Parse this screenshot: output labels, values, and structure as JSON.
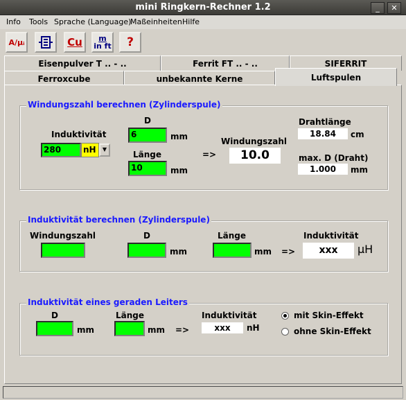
{
  "window": {
    "title": "mini Ringkern-Rechner 1.2",
    "minimize": "_",
    "maximize": "□",
    "close": "✕"
  },
  "menu": [
    "Info",
    "Tools",
    "Sprache (Language)",
    "Maßeinheiten",
    "Hilfe"
  ],
  "toolbar": {
    "btn1": "A/μᵢ",
    "btn3": "Cu",
    "btn4_top": "m",
    "btn4_bottom": "in ft",
    "btn5": "?"
  },
  "tabs_back": [
    "Eisenpulver T .. - ..",
    "Ferrit FT .. - ..",
    "SIFERRIT"
  ],
  "tabs_front": [
    "Ferroxcube",
    "unbekannte Kerne",
    "Luftspulen"
  ],
  "section1": {
    "title": "Windungszahl berechnen (Zylinderspule)",
    "inductance_label": "Induktivität",
    "inductance_value": "280",
    "inductance_unit": "nH",
    "d_label": "D",
    "d_value": "6",
    "d_unit": "mm",
    "length_label": "Länge",
    "length_value": "10",
    "length_unit": "mm",
    "arrow": "=>",
    "turns_label": "Windungszahl",
    "turns_value": "10.0",
    "wire_length_label": "Drahtlänge",
    "wire_length_value": "18.84",
    "wire_length_unit": "cm",
    "maxd_label": "max. D (Draht)",
    "maxd_value": "1.000",
    "maxd_unit": "mm"
  },
  "section2": {
    "title": "Induktivität berechnen (Zylinderspule)",
    "turns_label": "Windungszahl",
    "d_label": "D",
    "d_unit": "mm",
    "length_label": "Länge",
    "length_unit": "mm",
    "arrow": "=>",
    "ind_label": "Induktivität",
    "ind_value": "xxx",
    "ind_unit": "μH"
  },
  "section3": {
    "title": "Induktivität eines geraden Leiters",
    "d_label": "D",
    "d_unit": "mm",
    "length_label": "Länge",
    "length_unit": "mm",
    "arrow": "=>",
    "ind_label": "Induktivität",
    "ind_value": "xxx",
    "ind_unit": "nH",
    "radio_on": "mit Skin-Effekt",
    "radio_off": "ohne Skin-Effekt"
  }
}
